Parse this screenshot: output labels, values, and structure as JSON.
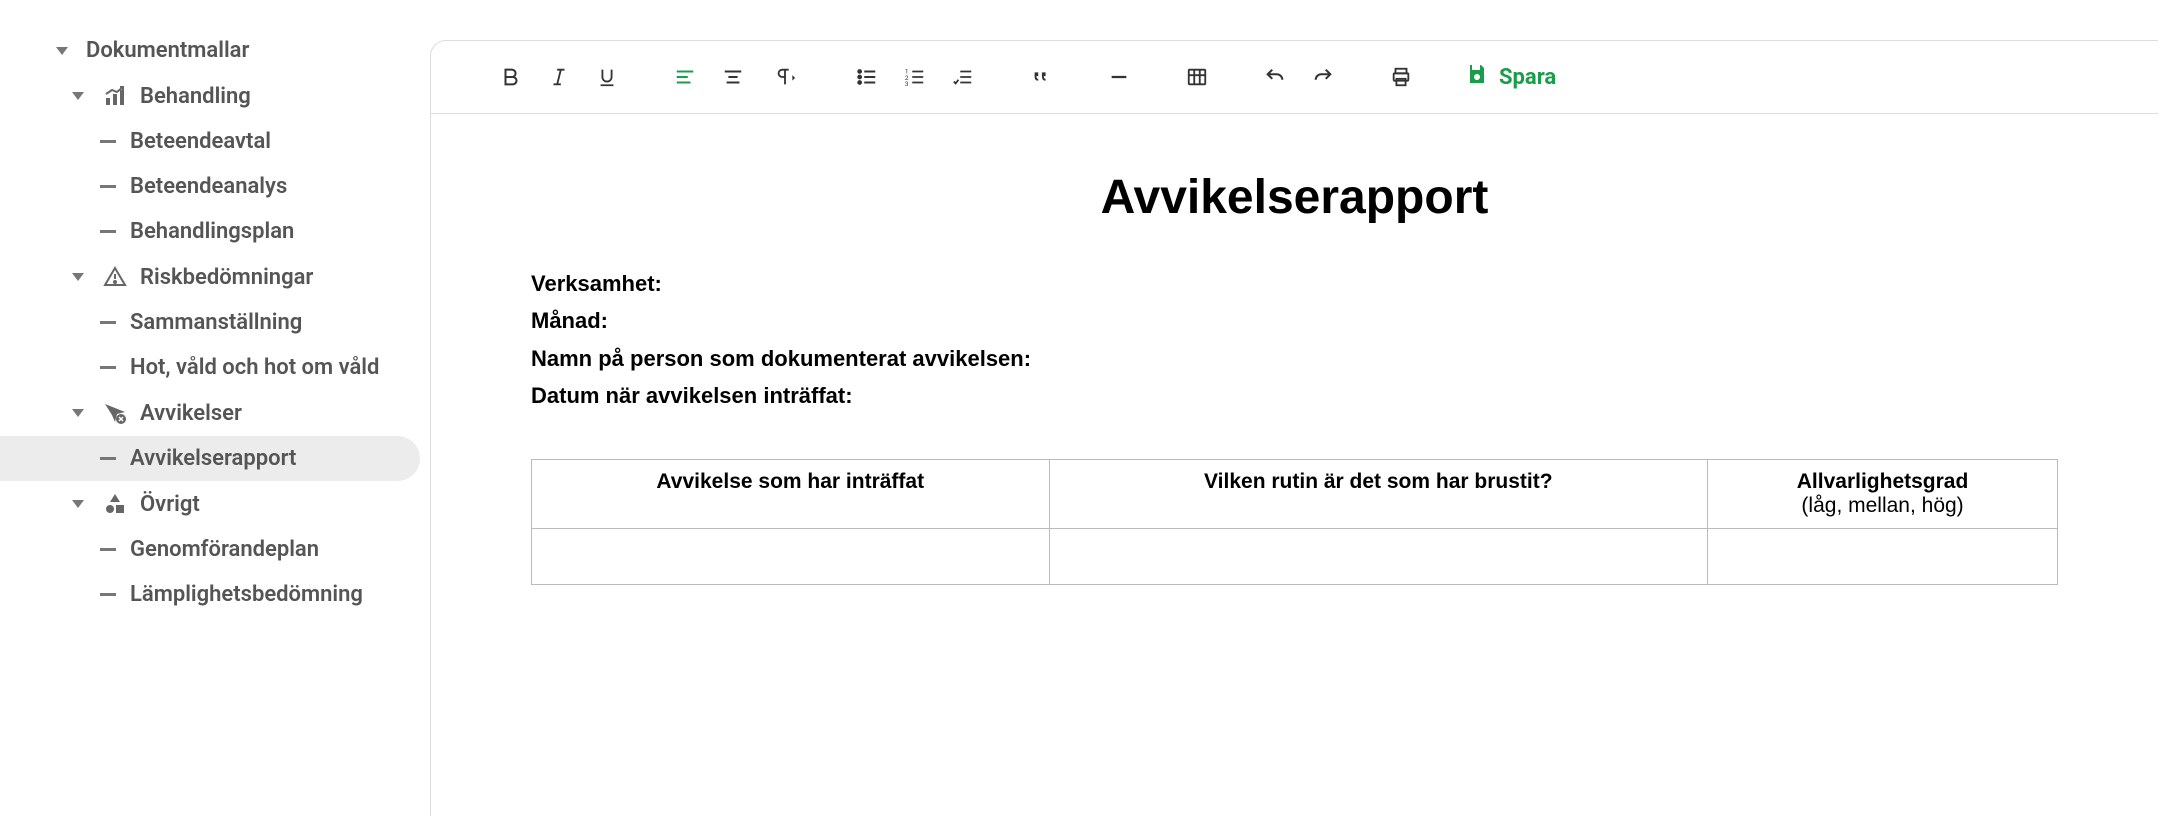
{
  "sidebar": {
    "root_label": "Dokumentmallar",
    "sections": [
      {
        "label": "Behandling",
        "icon": "chart",
        "leaves": [
          "Beteendeavtal",
          "Beteendeanalys",
          "Behandlingsplan"
        ]
      },
      {
        "label": "Riskbedömningar",
        "icon": "warning",
        "leaves": [
          "Sammanställning",
          "Hot, våld och hot om våld"
        ]
      },
      {
        "label": "Avvikelser",
        "icon": "paper-plane-x",
        "leaves": [
          "Avvikelserapport"
        ],
        "active_leaf": 0
      },
      {
        "label": "Övrigt",
        "icon": "shapes",
        "leaves": [
          "Genomförandeplan",
          "Lämplighetsbedömning"
        ]
      }
    ]
  },
  "toolbar": {
    "save_label": "Spara"
  },
  "document": {
    "title": "Avvikelserapport",
    "fields": [
      "Verksamhet:",
      "Månad:",
      "Namn på person som dokumenterat avvikelsen:",
      "Datum när avvikelsen inträffat:"
    ],
    "table": {
      "headers": [
        {
          "main": "Avvikelse som har inträffat",
          "sub": ""
        },
        {
          "main": "Vilken rutin är det som har brustit?",
          "sub": ""
        },
        {
          "main": "Allvarlighetsgrad",
          "sub": "(låg, mellan, hög)"
        }
      ],
      "rows": [
        [
          "",
          "",
          ""
        ]
      ]
    }
  }
}
